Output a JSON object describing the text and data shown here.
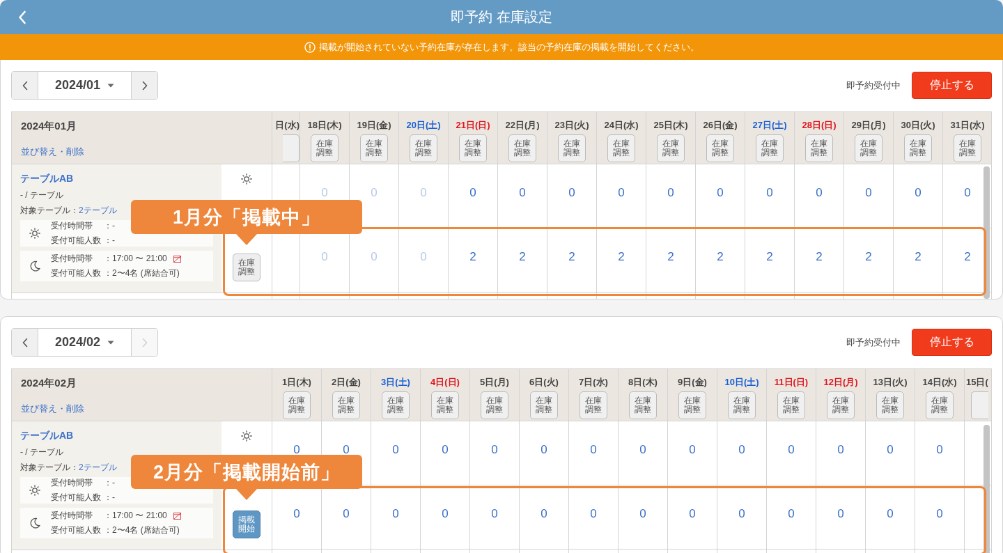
{
  "header": {
    "title": "即予約 在庫設定"
  },
  "banner": {
    "text": "掲載が開始されていない予約在庫が存在します。該当の予約在庫の掲載を開始してください。"
  },
  "months": [
    {
      "month": "2024/01",
      "next_disabled": false,
      "status": "即予約受付中",
      "stop_button": "停止する",
      "heading": "2024年01月",
      "sort_link": "並び替え・削除",
      "plan": {
        "name": "テーブルAB",
        "type": "- / テーブル",
        "target_label": "対象テーブル：",
        "target_link": "2テーブル",
        "slots": [
          {
            "kind": "day",
            "time_label": "受付時間帯",
            "time": "：-",
            "capacity_label": "受付可能人数",
            "capacity": "：-",
            "flag": false
          },
          {
            "kind": "night",
            "time_label": "受付時間帯",
            "time": "：17:00 〜 21:00",
            "capacity_label": "受付可能人数",
            "capacity": "：2〜4名 (席結合可)",
            "flag": true
          }
        ]
      },
      "row_action": {
        "kind": "adjust",
        "label": "在庫調整"
      },
      "columns": [
        {
          "kind": "cut_start",
          "label": "日(水)",
          "color": "#444444"
        },
        {
          "kind": "date",
          "label": "18日(木)",
          "color": "#444444",
          "button": "在庫調整",
          "values": [
            "0",
            "0"
          ],
          "muted": true
        },
        {
          "kind": "date",
          "label": "19日(金)",
          "color": "#444444",
          "button": "在庫調整",
          "values": [
            "0",
            "0"
          ],
          "muted": true
        },
        {
          "kind": "date",
          "label": "20日(土)",
          "color": "#1a5fd6",
          "button": "在庫調整",
          "values": [
            "0",
            "0"
          ],
          "muted": true
        },
        {
          "kind": "date",
          "label": "21日(日)",
          "color": "#e0141e",
          "button": "在庫調整",
          "values": [
            "0",
            "2"
          ],
          "muted": false
        },
        {
          "kind": "date",
          "label": "22日(月)",
          "color": "#444444",
          "button": "在庫調整",
          "values": [
            "0",
            "2"
          ],
          "muted": false
        },
        {
          "kind": "date",
          "label": "23日(火)",
          "color": "#444444",
          "button": "在庫調整",
          "values": [
            "0",
            "2"
          ],
          "muted": false
        },
        {
          "kind": "date",
          "label": "24日(水)",
          "color": "#444444",
          "button": "在庫調整",
          "values": [
            "0",
            "2"
          ],
          "muted": false
        },
        {
          "kind": "date",
          "label": "25日(木)",
          "color": "#444444",
          "button": "在庫調整",
          "values": [
            "0",
            "2"
          ],
          "muted": false
        },
        {
          "kind": "date",
          "label": "26日(金)",
          "color": "#444444",
          "button": "在庫調整",
          "values": [
            "0",
            "2"
          ],
          "muted": false
        },
        {
          "kind": "date",
          "label": "27日(土)",
          "color": "#1a5fd6",
          "button": "在庫調整",
          "values": [
            "0",
            "2"
          ],
          "muted": false
        },
        {
          "kind": "date",
          "label": "28日(日)",
          "color": "#e0141e",
          "button": "在庫調整",
          "values": [
            "0",
            "2"
          ],
          "muted": false
        },
        {
          "kind": "date",
          "label": "29日(月)",
          "color": "#444444",
          "button": "在庫調整",
          "values": [
            "0",
            "2"
          ],
          "muted": false
        },
        {
          "kind": "date",
          "label": "30日(火)",
          "color": "#444444",
          "button": "在庫調整",
          "values": [
            "0",
            "2"
          ],
          "muted": false
        },
        {
          "kind": "date",
          "label": "31日(水)",
          "color": "#444444",
          "button": "在庫調整",
          "values": [
            "0",
            "2"
          ],
          "muted": false
        }
      ],
      "callout": "1月分「掲載中」"
    },
    {
      "month": "2024/02",
      "next_disabled": true,
      "status": "即予約受付中",
      "stop_button": "停止する",
      "heading": "2024年02月",
      "sort_link": "並び替え・削除",
      "plan": {
        "name": "テーブルAB",
        "type": "- / テーブル",
        "target_label": "対象テーブル：",
        "target_link": "2テーブル",
        "slots": [
          {
            "kind": "day",
            "time_label": "受付時間帯",
            "time": "：-",
            "capacity_label": "受付可能人数",
            "capacity": "：-",
            "flag": false
          },
          {
            "kind": "night",
            "time_label": "受付時間帯",
            "time": "：17:00 〜 21:00",
            "capacity_label": "受付可能人数",
            "capacity": "：2〜4名 (席結合可)",
            "flag": true
          }
        ]
      },
      "row_action": {
        "kind": "publish",
        "label": "掲載開始"
      },
      "columns": [
        {
          "kind": "date",
          "label": "1日(木)",
          "color": "#444444",
          "button": "在庫調整",
          "values": [
            "0",
            "0"
          ],
          "muted": false
        },
        {
          "kind": "date",
          "label": "2日(金)",
          "color": "#444444",
          "button": "在庫調整",
          "values": [
            "0",
            "0"
          ],
          "muted": false
        },
        {
          "kind": "date",
          "label": "3日(土)",
          "color": "#1a5fd6",
          "button": "在庫調整",
          "values": [
            "0",
            "0"
          ],
          "muted": false
        },
        {
          "kind": "date",
          "label": "4日(日)",
          "color": "#e0141e",
          "button": "在庫調整",
          "values": [
            "0",
            "0"
          ],
          "muted": false
        },
        {
          "kind": "date",
          "label": "5日(月)",
          "color": "#444444",
          "button": "在庫調整",
          "values": [
            "0",
            "0"
          ],
          "muted": false
        },
        {
          "kind": "date",
          "label": "6日(火)",
          "color": "#444444",
          "button": "在庫調整",
          "values": [
            "0",
            "0"
          ],
          "muted": false
        },
        {
          "kind": "date",
          "label": "7日(水)",
          "color": "#444444",
          "button": "在庫調整",
          "values": [
            "0",
            "0"
          ],
          "muted": false
        },
        {
          "kind": "date",
          "label": "8日(木)",
          "color": "#444444",
          "button": "在庫調整",
          "values": [
            "0",
            "0"
          ],
          "muted": false
        },
        {
          "kind": "date",
          "label": "9日(金)",
          "color": "#444444",
          "button": "在庫調整",
          "values": [
            "0",
            "0"
          ],
          "muted": false
        },
        {
          "kind": "date",
          "label": "10日(土)",
          "color": "#1a5fd6",
          "button": "在庫調整",
          "values": [
            "0",
            "0"
          ],
          "muted": false
        },
        {
          "kind": "date",
          "label": "11日(日)",
          "color": "#e0141e",
          "button": "在庫調整",
          "values": [
            "0",
            "0"
          ],
          "muted": false
        },
        {
          "kind": "date",
          "label": "12日(月)",
          "color": "#e0141e",
          "button": "在庫調整",
          "values": [
            "0",
            "0"
          ],
          "muted": false
        },
        {
          "kind": "date",
          "label": "13日(火)",
          "color": "#444444",
          "button": "在庫調整",
          "values": [
            "0",
            "0"
          ],
          "muted": false
        },
        {
          "kind": "date",
          "label": "14日(水)",
          "color": "#444444",
          "button": "在庫調整",
          "values": [
            "0",
            "0"
          ],
          "muted": false
        },
        {
          "kind": "cut_end",
          "label": "15日(",
          "color": "#444444"
        }
      ],
      "callout": "2月分「掲載開始前」"
    }
  ]
}
